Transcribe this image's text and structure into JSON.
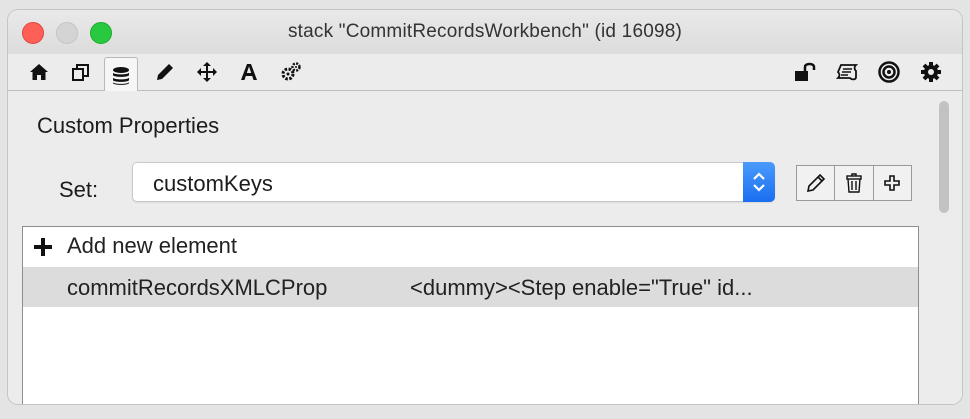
{
  "window": {
    "title": "stack \"CommitRecordsWorkbench\" (id 16098)"
  },
  "toolbar": {
    "left_tabs": [
      {
        "name": "home-icon"
      },
      {
        "name": "copy-icon"
      },
      {
        "name": "database-icon",
        "active": true
      },
      {
        "name": "pencil-icon"
      },
      {
        "name": "move-icon"
      },
      {
        "name": "text-icon"
      },
      {
        "name": "gears-icon"
      }
    ],
    "right_tabs": [
      {
        "name": "unlock-icon"
      },
      {
        "name": "script-icon"
      },
      {
        "name": "target-icon"
      },
      {
        "name": "gear-icon"
      }
    ]
  },
  "properties": {
    "section_title": "Custom Properties",
    "set_label": "Set:",
    "set_value": "customKeys",
    "actions": [
      "edit-icon",
      "trash-icon",
      "add-icon"
    ]
  },
  "list": {
    "add_label": "Add new element",
    "items": [
      {
        "key": "commitRecordsXMLCProp",
        "value": "<dummy><Step enable=\"True\" id..."
      }
    ]
  },
  "colors": {
    "select_accent": "#1b6ef0",
    "selected_row": "#dcdcdc"
  }
}
